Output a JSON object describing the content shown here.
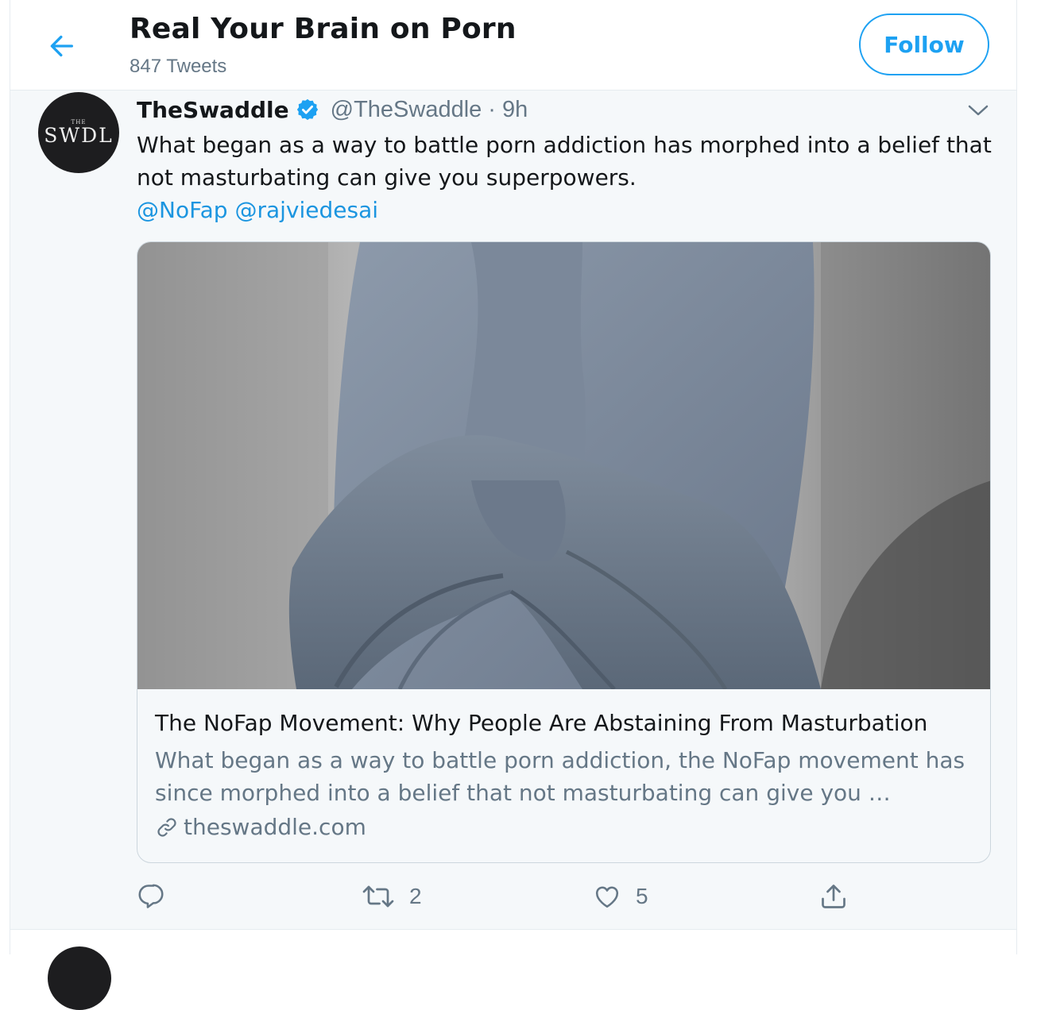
{
  "header": {
    "back_icon": "arrow-left-icon",
    "title": "Real Your Brain on Porn",
    "subtitle": "847 Tweets",
    "follow_label": "Follow"
  },
  "colors": {
    "accent": "#1da1f2",
    "link": "#1b95e0",
    "muted": "#657786",
    "text": "#14171a",
    "tweet_bg": "#f5f8fa"
  },
  "tweet": {
    "avatar": {
      "top_text": "THE",
      "main_text": "SWDL"
    },
    "display_name": "TheSwaddle",
    "verified_icon": "verified-badge-icon",
    "handle": "@TheSwaddle",
    "separator": "·",
    "time": "9h",
    "caret_icon": "chevron-down-icon",
    "text": "What began as a way to battle porn addiction has morphed into a belief that not masturbating can give you superpowers.",
    "mentions": [
      "@NoFap",
      "@rajviedesai"
    ],
    "card": {
      "image_desc_icon": "statue-photo",
      "title": "The NoFap Movement: Why People Are Abstaining From Masturbation",
      "description": "What began as a way to battle porn addiction, the NoFap movement has since morphed into a belief that not masturbating can give you …",
      "link_icon": "link-icon",
      "domain": "theswaddle.com"
    },
    "actions": {
      "reply": {
        "icon": "reply-icon",
        "count": ""
      },
      "retweet": {
        "icon": "retweet-icon",
        "count": "2"
      },
      "like": {
        "icon": "heart-icon",
        "count": "5"
      },
      "share": {
        "icon": "share-icon",
        "count": ""
      }
    }
  }
}
